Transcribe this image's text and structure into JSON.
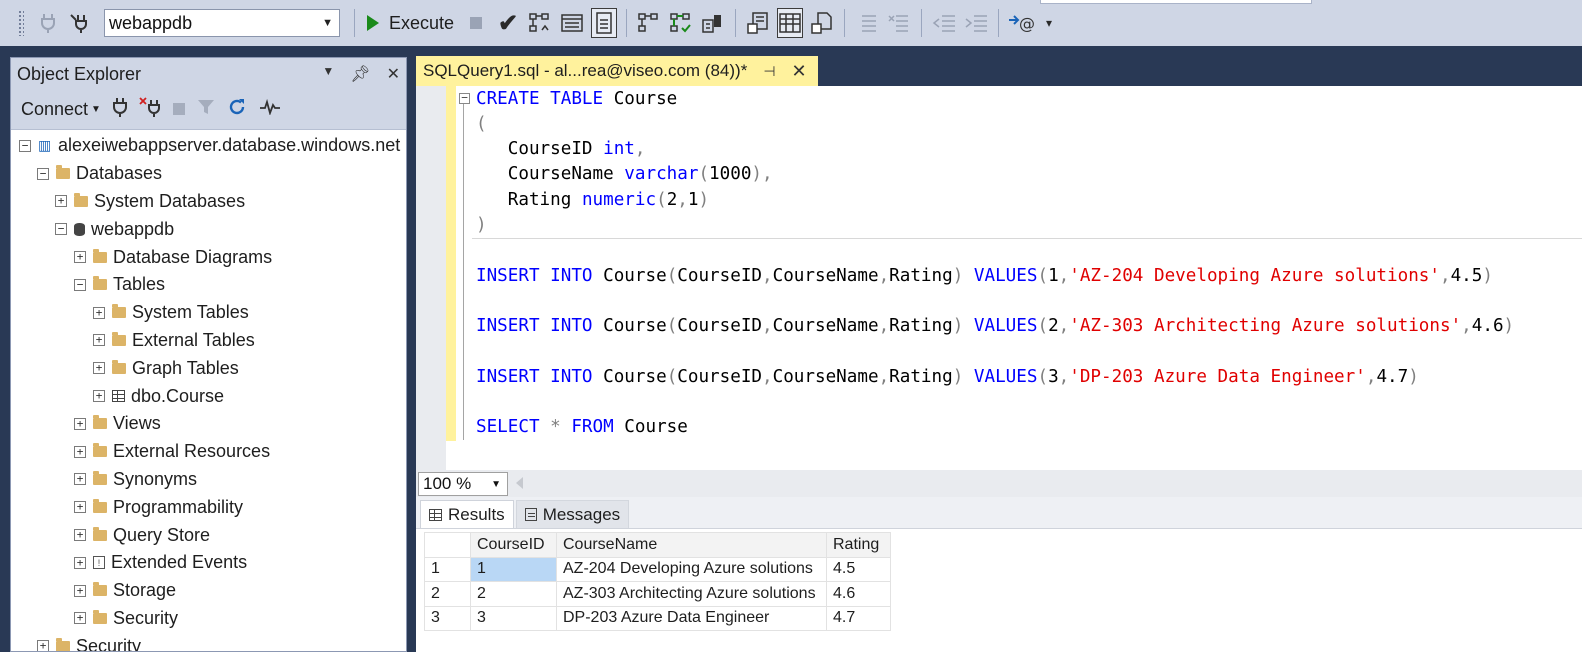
{
  "toolbar": {
    "database": "webappdb",
    "execute_label": "Execute"
  },
  "object_explorer": {
    "title": "Object Explorer",
    "connect_label": "Connect",
    "tree": [
      {
        "label": "alexeiwebappserver.database.windows.net (S",
        "level": 0,
        "icon": "server-icon",
        "expander": "minus"
      },
      {
        "label": "Databases",
        "level": 1,
        "icon": "folder-icon",
        "expander": "minus"
      },
      {
        "label": "System Databases",
        "level": 2,
        "icon": "folder-icon",
        "expander": "plus"
      },
      {
        "label": "webappdb",
        "level": 2,
        "icon": "database-icon",
        "expander": "minus"
      },
      {
        "label": "Database Diagrams",
        "level": 3,
        "icon": "folder-icon",
        "expander": "plus"
      },
      {
        "label": "Tables",
        "level": 3,
        "icon": "folder-icon",
        "expander": "minus"
      },
      {
        "label": "System Tables",
        "level": 4,
        "icon": "folder-icon",
        "expander": "plus"
      },
      {
        "label": "External Tables",
        "level": 4,
        "icon": "folder-icon",
        "expander": "plus"
      },
      {
        "label": "Graph Tables",
        "level": 4,
        "icon": "folder-icon",
        "expander": "plus"
      },
      {
        "label": "dbo.Course",
        "level": 4,
        "icon": "table-icon",
        "expander": "plus"
      },
      {
        "label": "Views",
        "level": 3,
        "icon": "folder-icon",
        "expander": "plus"
      },
      {
        "label": "External Resources",
        "level": 3,
        "icon": "folder-icon",
        "expander": "plus"
      },
      {
        "label": "Synonyms",
        "level": 3,
        "icon": "folder-icon",
        "expander": "plus"
      },
      {
        "label": "Programmability",
        "level": 3,
        "icon": "folder-icon",
        "expander": "plus"
      },
      {
        "label": "Query Store",
        "level": 3,
        "icon": "folder-icon",
        "expander": "plus"
      },
      {
        "label": "Extended Events",
        "level": 3,
        "icon": "event-icon",
        "expander": "plus"
      },
      {
        "label": "Storage",
        "level": 3,
        "icon": "folder-icon",
        "expander": "plus"
      },
      {
        "label": "Security",
        "level": 3,
        "icon": "folder-icon",
        "expander": "plus"
      },
      {
        "label": "Security",
        "level": 1,
        "icon": "folder-icon",
        "expander": "plus"
      }
    ]
  },
  "editor": {
    "tab_title": "SQLQuery1.sql - al...rea@viseo.com (84))*",
    "lines": [
      [
        {
          "t": "CREATE",
          "c": "kw"
        },
        {
          "t": " "
        },
        {
          "t": "TABLE",
          "c": "kw"
        },
        {
          "t": " Course"
        }
      ],
      [
        {
          "t": "(",
          "c": "pun"
        }
      ],
      [
        {
          "t": "   CourseID "
        },
        {
          "t": "int",
          "c": "kw"
        },
        {
          "t": ",",
          "c": "pun"
        }
      ],
      [
        {
          "t": "   CourseName "
        },
        {
          "t": "varchar",
          "c": "kw"
        },
        {
          "t": "(",
          "c": "pun"
        },
        {
          "t": "1000"
        },
        {
          "t": "),",
          "c": "pun"
        }
      ],
      [
        {
          "t": "   Rating "
        },
        {
          "t": "numeric",
          "c": "kw"
        },
        {
          "t": "(",
          "c": "pun"
        },
        {
          "t": "2"
        },
        {
          "t": ",",
          "c": "pun"
        },
        {
          "t": "1"
        },
        {
          "t": ")",
          "c": "pun"
        }
      ],
      [
        {
          "t": ")",
          "c": "pun"
        }
      ],
      [],
      [
        {
          "t": "INSERT",
          "c": "kw"
        },
        {
          "t": " "
        },
        {
          "t": "INTO",
          "c": "kw"
        },
        {
          "t": " Course"
        },
        {
          "t": "(",
          "c": "pun"
        },
        {
          "t": "CourseID"
        },
        {
          "t": ",",
          "c": "pun"
        },
        {
          "t": "CourseName"
        },
        {
          "t": ",",
          "c": "pun"
        },
        {
          "t": "Rating"
        },
        {
          "t": ")",
          "c": "pun"
        },
        {
          "t": " "
        },
        {
          "t": "VALUES",
          "c": "kw"
        },
        {
          "t": "(",
          "c": "pun"
        },
        {
          "t": "1"
        },
        {
          "t": ",",
          "c": "pun"
        },
        {
          "t": "'AZ-204 Developing Azure solutions'",
          "c": "str"
        },
        {
          "t": ",",
          "c": "pun"
        },
        {
          "t": "4.5"
        },
        {
          "t": ")",
          "c": "pun"
        }
      ],
      [],
      [
        {
          "t": "INSERT",
          "c": "kw"
        },
        {
          "t": " "
        },
        {
          "t": "INTO",
          "c": "kw"
        },
        {
          "t": " Course"
        },
        {
          "t": "(",
          "c": "pun"
        },
        {
          "t": "CourseID"
        },
        {
          "t": ",",
          "c": "pun"
        },
        {
          "t": "CourseName"
        },
        {
          "t": ",",
          "c": "pun"
        },
        {
          "t": "Rating"
        },
        {
          "t": ")",
          "c": "pun"
        },
        {
          "t": " "
        },
        {
          "t": "VALUES",
          "c": "kw"
        },
        {
          "t": "(",
          "c": "pun"
        },
        {
          "t": "2"
        },
        {
          "t": ",",
          "c": "pun"
        },
        {
          "t": "'AZ-303 Architecting Azure solutions'",
          "c": "str"
        },
        {
          "t": ",",
          "c": "pun"
        },
        {
          "t": "4.6"
        },
        {
          "t": ")",
          "c": "pun"
        }
      ],
      [],
      [
        {
          "t": "INSERT",
          "c": "kw"
        },
        {
          "t": " "
        },
        {
          "t": "INTO",
          "c": "kw"
        },
        {
          "t": " Course"
        },
        {
          "t": "(",
          "c": "pun"
        },
        {
          "t": "CourseID"
        },
        {
          "t": ",",
          "c": "pun"
        },
        {
          "t": "CourseName"
        },
        {
          "t": ",",
          "c": "pun"
        },
        {
          "t": "Rating"
        },
        {
          "t": ")",
          "c": "pun"
        },
        {
          "t": " "
        },
        {
          "t": "VALUES",
          "c": "kw"
        },
        {
          "t": "(",
          "c": "pun"
        },
        {
          "t": "3"
        },
        {
          "t": ",",
          "c": "pun"
        },
        {
          "t": "'DP-203 Azure Data Engineer'",
          "c": "str"
        },
        {
          "t": ",",
          "c": "pun"
        },
        {
          "t": "4.7"
        },
        {
          "t": ")",
          "c": "pun"
        }
      ],
      [],
      [
        {
          "t": "SELECT",
          "c": "kw"
        },
        {
          "t": " "
        },
        {
          "t": "*",
          "c": "op"
        },
        {
          "t": " "
        },
        {
          "t": "FROM",
          "c": "kw"
        },
        {
          "t": " Course"
        }
      ]
    ],
    "zoom": "100 %"
  },
  "results": {
    "tabs": {
      "results": "Results",
      "messages": "Messages"
    },
    "columns": [
      "CourseID",
      "CourseName",
      "Rating"
    ],
    "rows": [
      {
        "n": "1",
        "cells": [
          "1",
          "AZ-204 Developing Azure solutions",
          "4.5"
        ]
      },
      {
        "n": "2",
        "cells": [
          "2",
          "AZ-303 Architecting Azure solutions",
          "4.6"
        ]
      },
      {
        "n": "3",
        "cells": [
          "3",
          "DP-203 Azure Data Engineer",
          "4.7"
        ]
      }
    ]
  },
  "colors": {
    "keyword": "#0000ff",
    "string": "#e00000",
    "tab_highlight": "#fff29d",
    "chrome": "#cfd6e5",
    "frame": "#293955"
  }
}
